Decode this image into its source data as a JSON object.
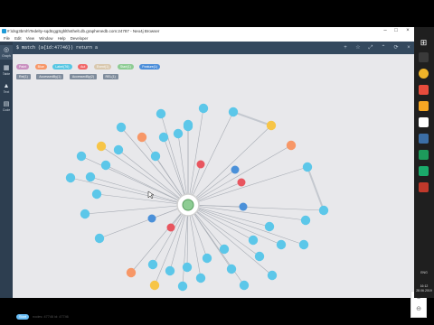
{
  "window": {
    "title": "#:\\dsg3bmh\\Tedelty-sqdtcggSghlthsthelt.db.graphenedb.com:24787 - Neo4j Browser",
    "menu": [
      "File",
      "Edit",
      "View",
      "Window",
      "Help",
      "Developer"
    ]
  },
  "sidebar": {
    "items": [
      {
        "label": "Graph",
        "icon": "graph-icon"
      },
      {
        "label": "Table",
        "icon": "table-icon"
      },
      {
        "label": "Text",
        "icon": "text-icon"
      },
      {
        "label": "Code",
        "icon": "code-icon"
      }
    ]
  },
  "editor": {
    "query": "$ match (a{id:47746}) return a"
  },
  "labels": [
    {
      "text": "Paint",
      "color": "#c990c0"
    },
    {
      "text": "Blue",
      "color": "#f79767"
    },
    {
      "text": "Label(76)",
      "color": "#57c7e3"
    },
    {
      "text": "Aut",
      "color": "#f16667"
    },
    {
      "text": "Event(1)",
      "color": "#d9c8ae"
    },
    {
      "text": "Start(1)",
      "color": "#8dcc93"
    },
    {
      "text": "Feature(1)",
      "color": "#4c8eda"
    }
  ],
  "relationships": [
    "Rel(1)",
    "AccessedBy(1)",
    "AccessedBy(2)",
    "REL(1)"
  ],
  "footer": {
    "badge": "Start",
    "summary": "nodes: 47746",
    "extra": "id: 47746"
  },
  "clock": {
    "time": "16:12",
    "date": "28.06.2019",
    "lang": "ENG"
  }
}
